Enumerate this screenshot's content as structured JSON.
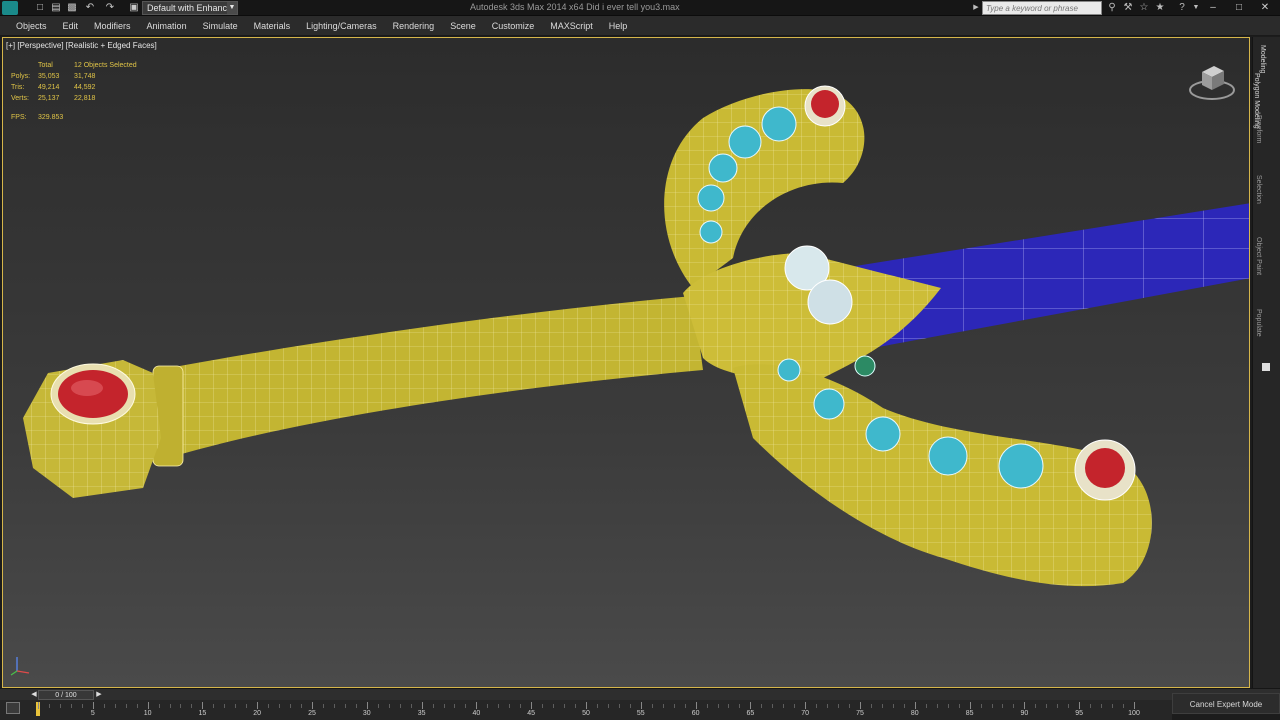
{
  "titlebar": {
    "workspace": "Default with Enhance",
    "window_title": "Autodesk 3ds Max 2014 x64     Did i ever tell you3.max",
    "search_placeholder": "Type a keyword or phrase"
  },
  "menu": [
    "Objects",
    "Edit",
    "Modifiers",
    "Animation",
    "Simulate",
    "Materials",
    "Lighting/Cameras",
    "Rendering",
    "Scene",
    "Customize",
    "MAXScript",
    "Help"
  ],
  "viewport": {
    "label": "[+] [Perspective] [Realistic + Edged Faces]",
    "stats": {
      "header": [
        "",
        "Total",
        "12 Objects Selected"
      ],
      "rows": [
        [
          "Polys:",
          "35,053",
          "31,748"
        ],
        [
          "Tris:",
          "49,214",
          "44,592"
        ],
        [
          "Verts:",
          "25,137",
          "22,818"
        ]
      ],
      "fps_label": "FPS:",
      "fps_value": "329.853"
    }
  },
  "command_panel": {
    "tabs": [
      "Modeling",
      "Polygon Modeling",
      "Freeform",
      "Selection",
      "Object Paint",
      "Populate"
    ]
  },
  "timeline": {
    "counter": "0 / 100",
    "cancel": "Cancel Expert Mode",
    "ticks": [
      "5",
      "10",
      "15",
      "20",
      "25",
      "30",
      "35",
      "40",
      "45",
      "50",
      "55",
      "60",
      "65",
      "70",
      "75",
      "80",
      "85",
      "90",
      "95",
      "100"
    ]
  },
  "colors": {
    "viewport_border": "#d6b64a",
    "gold": "#c9b93a",
    "blade": "#2c27b8",
    "ruby": "#c4242c",
    "turquoise": "#3fb8cc",
    "stats_text": "#e0c447"
  }
}
